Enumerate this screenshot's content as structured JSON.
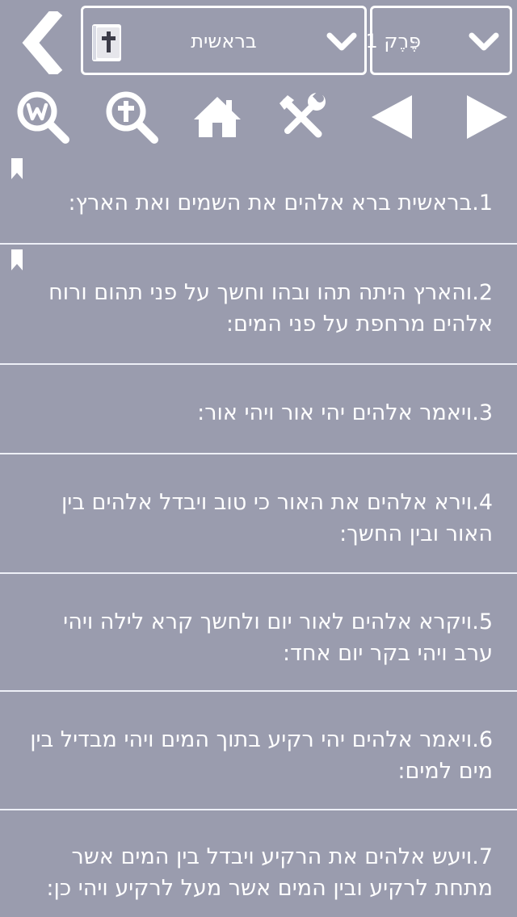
{
  "header": {
    "book_name": "בראשית",
    "chapter_label": "פֶּרֶק 1"
  },
  "verses": [
    {
      "text": "1.בראשית ברא אלהים את השמים ואת הארץ:",
      "bookmarked": true
    },
    {
      "text": "2.והארץ היתה תהו ובהו וחשך על פני תהום ורוח אלהים מרחפת על פני המים:",
      "bookmarked": true
    },
    {
      "text": "3.ויאמר אלהים יהי אור ויהי אור:",
      "bookmarked": false
    },
    {
      "text": "4.וירא אלהים את האור כי טוב ויבדל אלהים בין האור ובין החשך:",
      "bookmarked": false
    },
    {
      "text": "5.ויקרא אלהים לאור יום ולחשך קרא לילה ויהי ערב ויהי בקר יום אחד:",
      "bookmarked": false
    },
    {
      "text": "6.ויאמר אלהים יהי רקיע בתוך המים ויהי מבדיל בין מים למים:",
      "bookmarked": false
    },
    {
      "text": "7.ויעש אלהים את הרקיע ויבדל בין המים אשר מתחת לרקיע ובין המים אשר מעל לרקיע ויהי כן:",
      "bookmarked": false
    }
  ],
  "colors": {
    "background": "#9a9cae",
    "foreground": "#ffffff",
    "divider": "#eef0f7"
  }
}
